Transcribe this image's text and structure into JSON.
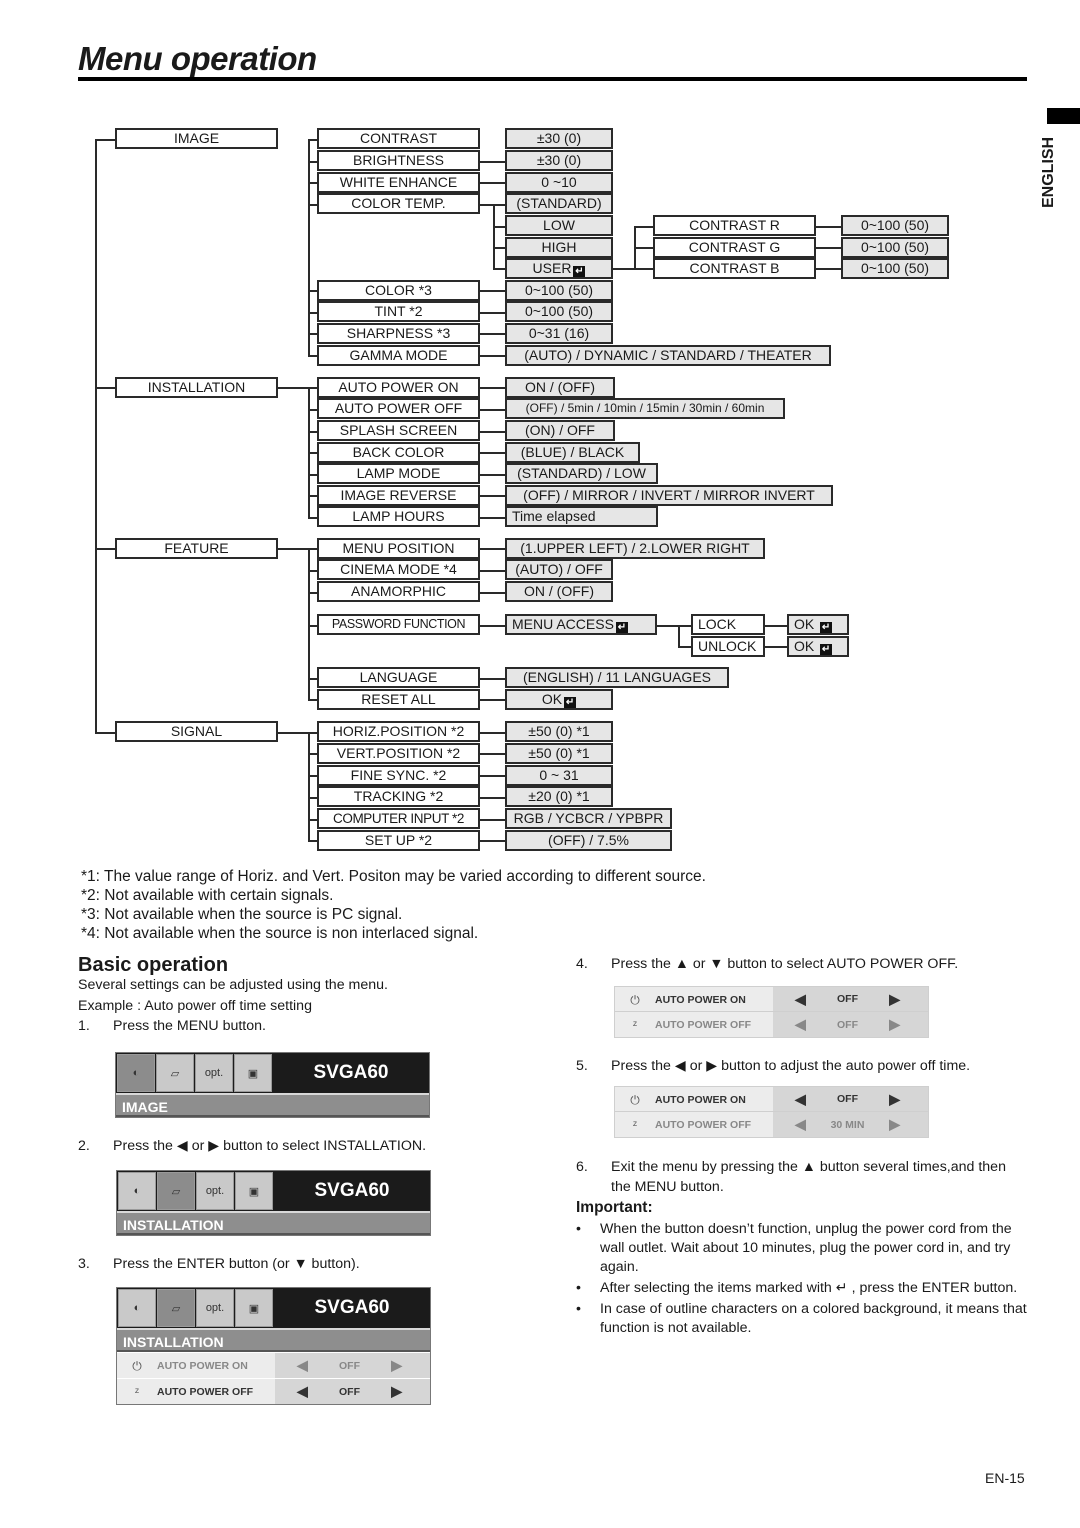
{
  "page": {
    "title": "Menu operation",
    "language_tab": "ENGLISH",
    "page_number": "EN-15"
  },
  "tree": {
    "image": {
      "label": "IMAGE",
      "items": [
        {
          "label": "CONTRAST",
          "value": "±30 (0)"
        },
        {
          "label": "BRIGHTNESS",
          "value": "±30 (0)"
        },
        {
          "label": "WHITE ENHANCE",
          "value": "0 ~10"
        },
        {
          "label": "COLOR TEMP.",
          "value": "(STANDARD)"
        },
        {
          "label": "COLOR   *3",
          "value": "0~100 (50)"
        },
        {
          "label": "TINT    *2",
          "value": "0~100 (50)"
        },
        {
          "label": "SHARPNESS *3",
          "value": "0~31 (16)"
        },
        {
          "label": "GAMMA MODE",
          "value": "(AUTO) / DYNAMIC / STANDARD / THEATER"
        }
      ],
      "color_temp_options": [
        "LOW",
        "HIGH",
        "USER"
      ],
      "user_items": [
        {
          "label": "CONTRAST R",
          "value": "0~100 (50)"
        },
        {
          "label": "CONTRAST G",
          "value": "0~100 (50)"
        },
        {
          "label": "CONTRAST B",
          "value": "0~100 (50)"
        }
      ]
    },
    "installation": {
      "label": "INSTALLATION",
      "items": [
        {
          "label": "AUTO POWER ON",
          "value": "ON / (OFF)"
        },
        {
          "label": "AUTO POWER OFF",
          "value": "(OFF) / 5min / 10min / 15min / 30min / 60min"
        },
        {
          "label": "SPLASH SCREEN",
          "value": "(ON) / OFF"
        },
        {
          "label": "BACK COLOR",
          "value": "(BLUE) / BLACK"
        },
        {
          "label": "LAMP MODE",
          "value": "(STANDARD) / LOW"
        },
        {
          "label": "IMAGE REVERSE",
          "value": "(OFF) / MIRROR / INVERT / MIRROR INVERT"
        },
        {
          "label": "LAMP HOURS",
          "value": "Time elapsed"
        }
      ]
    },
    "feature": {
      "label": "FEATURE",
      "items": [
        {
          "label": "MENU POSITION",
          "value": "(1.UPPER LEFT) / 2.LOWER RIGHT"
        },
        {
          "label": "CINEMA MODE *4",
          "value": "(AUTO) / OFF"
        },
        {
          "label": "ANAMORPHIC",
          "value": "ON / (OFF)"
        },
        {
          "label": "PASSWORD FUNCTION",
          "value": "MENU ACCESS"
        },
        {
          "label": "LANGUAGE",
          "value": "(ENGLISH) / 11 LANGUAGES"
        },
        {
          "label": "RESET ALL",
          "value": "OK"
        }
      ],
      "password_options": [
        {
          "label": "LOCK",
          "value": "OK"
        },
        {
          "label": "UNLOCK",
          "value": "OK"
        }
      ]
    },
    "signal": {
      "label": "SIGNAL",
      "items": [
        {
          "label": "HORIZ.POSITION *2",
          "value": "±50 (0)  *1"
        },
        {
          "label": "VERT.POSITION *2",
          "value": "±50 (0)  *1"
        },
        {
          "label": "FINE SYNC. *2",
          "value": "0 ~ 31"
        },
        {
          "label": "TRACKING *2",
          "value": "±20 (0)  *1"
        },
        {
          "label": "COMPUTER INPUT *2",
          "value": "RGB / YCBCR / YPBPR"
        },
        {
          "label": "SET UP *2",
          "value": "(OFF) / 7.5%"
        }
      ]
    },
    "enter_glyph": "↵"
  },
  "footnotes": [
    "*1: The value range of Horiz. and Vert. Positon may be varied according to different source.",
    "*2: Not available with certain signals.",
    "*3: Not available when the source is PC signal.",
    "*4: Not available when the source is non interlaced signal."
  ],
  "basic": {
    "heading": "Basic operation",
    "intro": "Several settings can be adjusted using the menu.",
    "example": "Example : Auto power off time setting",
    "steps": [
      {
        "num": "1.",
        "text": "Press the MENU button."
      },
      {
        "num": "2.",
        "text": "Press the ◀ or ▶ button to select INSTALLATION."
      },
      {
        "num": "3.",
        "text": "Press the ENTER button (or ▼ button)."
      },
      {
        "num": "4.",
        "text": "Press the ▲ or ▼ button to select AUTO POWER OFF."
      },
      {
        "num": "5.",
        "text": "Press the ◀ or ▶ button to adjust the auto power off time."
      },
      {
        "num": "6.",
        "text": "Exit the menu by pressing the ▲ button several times,and then the MENU button."
      }
    ]
  },
  "osd": {
    "model": "SVGA60",
    "icons": [
      "contrast-brightness",
      "installation",
      "opt.",
      "signal"
    ],
    "opt_label": "opt.",
    "screens": [
      {
        "section": "IMAGE"
      },
      {
        "section": "INSTALLATION"
      },
      {
        "section": "INSTALLATION",
        "rows": [
          {
            "label": "AUTO POWER ON",
            "value": "OFF"
          },
          {
            "label": "AUTO POWER OFF",
            "value": "OFF"
          }
        ]
      }
    ],
    "step4_rows": [
      {
        "label": "AUTO POWER ON",
        "value": "OFF"
      },
      {
        "label": "AUTO POWER OFF",
        "value": "OFF"
      }
    ],
    "step5_rows": [
      {
        "label": "AUTO POWER ON",
        "value": "OFF"
      },
      {
        "label": "AUTO POWER OFF",
        "value": "30 MIN"
      }
    ]
  },
  "important": {
    "heading": "Important:",
    "bullets": [
      "When the button doesn’t function, unplug the power cord from the wall outlet. Wait about 10 minutes, plug the power cord in, and try again.",
      "After selecting the items marked with ↵ , press the ENTER button.",
      "In case of outline characters on a colored background, it means that function is not available."
    ]
  }
}
